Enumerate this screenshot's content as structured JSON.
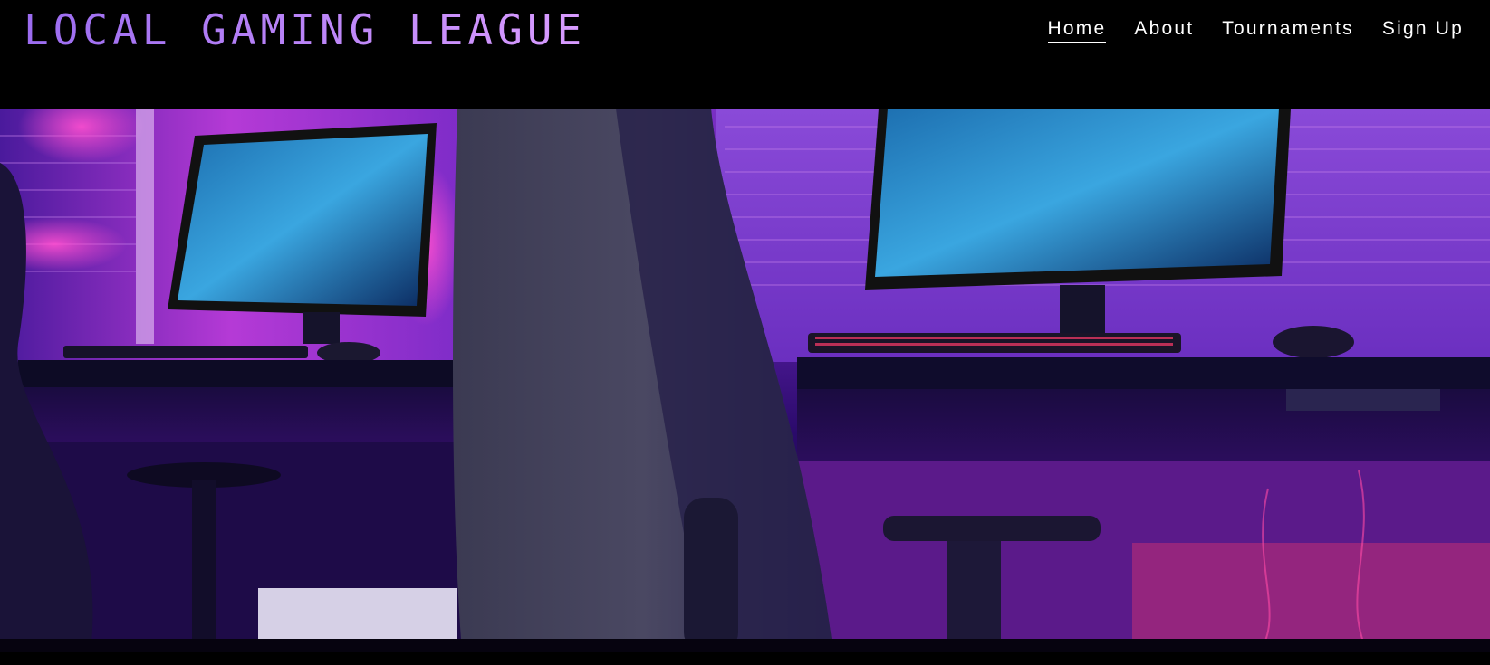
{
  "site": {
    "title": "LOCAL GAMING LEAGUE"
  },
  "nav": {
    "items": [
      {
        "label": "Home",
        "active": true
      },
      {
        "label": "About",
        "active": false
      },
      {
        "label": "Tournaments",
        "active": false
      },
      {
        "label": "Sign Up",
        "active": false
      }
    ]
  },
  "hero": {
    "image": "gaming-room-photo",
    "description": ""
  },
  "colors": {
    "logo": "#c98df5",
    "background": "#000000",
    "nav_text": "#ffffff",
    "hero_accent": "#b44cff"
  }
}
